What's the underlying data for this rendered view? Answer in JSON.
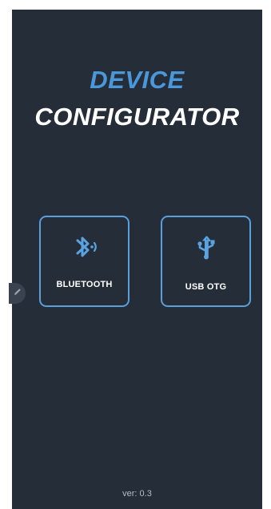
{
  "header": {
    "title_line1": "DEVICE",
    "title_line2": "CONFIGURATOR"
  },
  "connections": [
    {
      "label": "BLUETOOTH",
      "icon": "bluetooth-icon"
    },
    {
      "label": "USB OTG",
      "icon": "usb-icon"
    }
  ],
  "side_handle": {
    "icon": "pencil-icon"
  },
  "footer": {
    "version": "ver: 0.3"
  },
  "colors": {
    "background": "#252d38",
    "accent": "#4a97d9",
    "button_border": "#5a9fdc",
    "text": "#ffffff",
    "muted_text": "#b8bcc2"
  }
}
